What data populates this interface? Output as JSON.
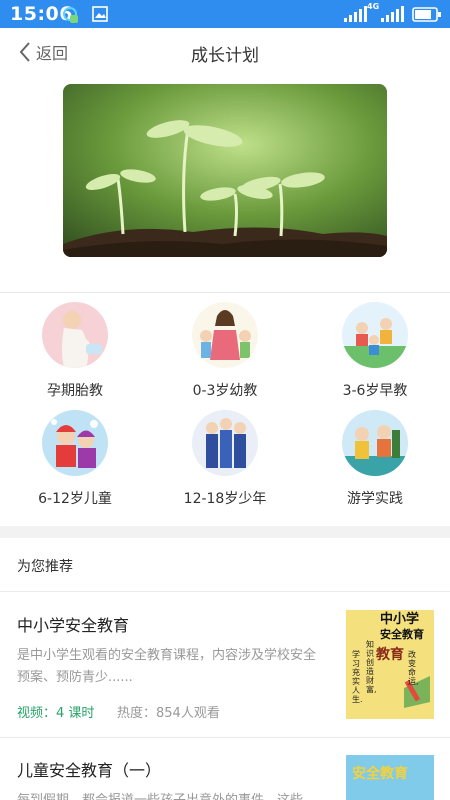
{
  "status_bar": {
    "time": "15:06",
    "network_label": "4G",
    "bar_color": "#2f8df0"
  },
  "nav": {
    "back_label": "返回",
    "title": "成长计划"
  },
  "categories": [
    {
      "label": "孕期胎教"
    },
    {
      "label": "0-3岁幼教"
    },
    {
      "label": "3-6岁早教"
    },
    {
      "label": "6-12岁儿童"
    },
    {
      "label": "12-18岁少年"
    },
    {
      "label": "游学实践"
    }
  ],
  "recommend": {
    "section_title": "为您推荐",
    "items": [
      {
        "title": "中小学安全教育",
        "desc": "是中小学生观看的安全教育课程，内容涉及学校安全预案、预防青少......",
        "video": "视频：4 课时",
        "heat": "热度：854人观看",
        "thumb_text": [
          "中小学",
          "安全教育",
          "教育",
          "改变命运,",
          "知识创造财富,",
          "学习充实人生."
        ]
      },
      {
        "title": "儿童安全教育（一）",
        "desc": "每到假期，都会报道一些孩子出意外的事件，这些",
        "thumb_text": [
          "安全教育"
        ]
      }
    ]
  },
  "colors": {
    "accent_green": "#29a36a",
    "muted_text": "#999999"
  }
}
